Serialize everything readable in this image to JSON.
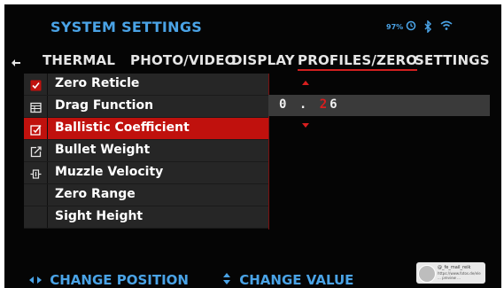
{
  "header": {
    "title": "SYSTEM SETTINGS",
    "battery": "97%",
    "icons": [
      "clock-circle-icon",
      "bluetooth-icon",
      "wifi-icon"
    ]
  },
  "tabs": [
    {
      "label": "THERMAL",
      "active": false
    },
    {
      "label": "PHOTO/VIDEO",
      "active": false
    },
    {
      "label": "DISPLAY",
      "active": false
    },
    {
      "label": "PROFILES/ZERO",
      "active": true
    },
    {
      "label": "SETTINGS",
      "active": false
    }
  ],
  "menu": {
    "items": [
      {
        "label": "Zero Reticle",
        "icon": "checkbox-checked-icon",
        "selected": false
      },
      {
        "label": "Drag Function",
        "icon": "table-grid-icon",
        "selected": false
      },
      {
        "label": "Ballistic Coefficient",
        "icon": "edit-checkbox-icon",
        "selected": true
      },
      {
        "label": "Bullet Weight",
        "icon": "external-edit-icon",
        "selected": false
      },
      {
        "label": "Muzzle Velocity",
        "icon": "velocity-icon",
        "selected": false
      },
      {
        "label": "Zero Range",
        "icon": "",
        "selected": false
      },
      {
        "label": "Sight Height",
        "icon": "",
        "selected": false
      }
    ]
  },
  "value_editor": {
    "prefix": "0 . ",
    "highlight": "2",
    "suffix": "6"
  },
  "footer": {
    "change_position": "CHANGE POSITION",
    "change_value": "CHANGE VALUE"
  },
  "notification": {
    "name": "@_fe_mail_reik",
    "text": "https://www.fotos.de/ele ... preview ..."
  },
  "colors": {
    "accent_blue": "#4aa3e6",
    "selection_red": "#c0110d",
    "background": "#050505"
  }
}
